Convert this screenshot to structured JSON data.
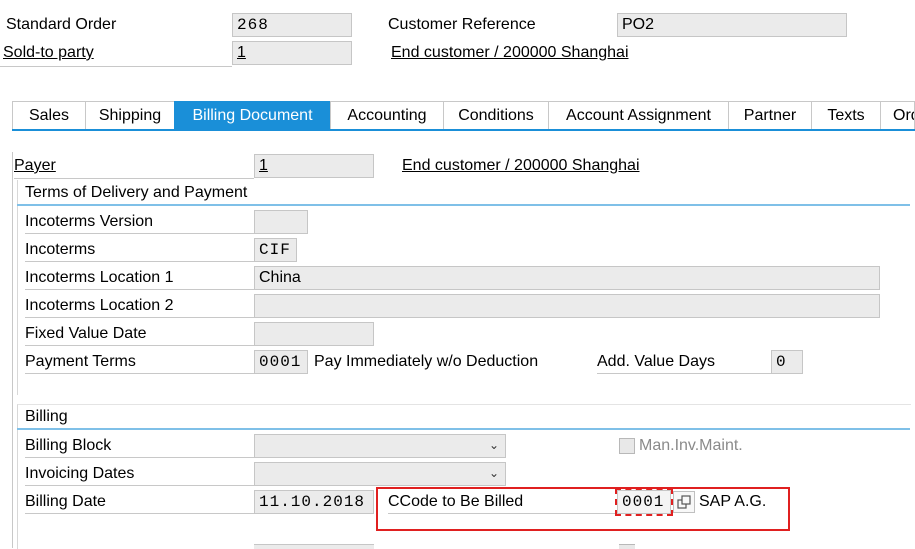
{
  "header": {
    "order_type_label": "Standard Order",
    "order_number": "268",
    "customer_reference_label": "Customer Reference",
    "customer_reference_value": "PO2",
    "sold_to_label": "Sold-to party",
    "sold_to_value": "1",
    "sold_to_name": "End customer / 200000 Shanghai"
  },
  "tabs": [
    {
      "label": "Sales"
    },
    {
      "label": "Shipping"
    },
    {
      "label": "Billing Document",
      "active": true
    },
    {
      "label": "Accounting"
    },
    {
      "label": "Conditions"
    },
    {
      "label": "Account Assignment"
    },
    {
      "label": "Partner"
    },
    {
      "label": "Texts"
    },
    {
      "label": "Ord"
    }
  ],
  "payer": {
    "label": "Payer",
    "value": "1",
    "name": "End customer / 200000 Shanghai"
  },
  "terms": {
    "title": "Terms of Delivery and Payment",
    "incoterms_version_label": "Incoterms Version",
    "incoterms_version_value": "",
    "incoterms_label": "Incoterms",
    "incoterms_value": "CIF",
    "incoterms_loc1_label": "Incoterms Location 1",
    "incoterms_loc1_value": "China",
    "incoterms_loc2_label": "Incoterms Location 2",
    "incoterms_loc2_value": "",
    "fixed_value_date_label": "Fixed Value Date",
    "fixed_value_date_value": "",
    "payment_terms_label": "Payment Terms",
    "payment_terms_code": "0001",
    "payment_terms_text": "Pay Immediately w/o Deduction",
    "add_value_days_label": "Add. Value Days",
    "add_value_days_value": "0"
  },
  "billing": {
    "title": "Billing",
    "billing_block_label": "Billing Block",
    "billing_block_value": "",
    "man_inv_maint_label": "Man.Inv.Maint.",
    "invoicing_dates_label": "Invoicing Dates",
    "invoicing_dates_value": "",
    "billing_date_label": "Billing Date",
    "billing_date_value": "11.10.2018",
    "ccode_label": "CCode to Be Billed",
    "ccode_value": "0001",
    "ccode_name": "SAP A.G."
  },
  "colors": {
    "accent": "#1a8fd8",
    "highlight": "#e02020",
    "field_bg": "#ebebeb"
  }
}
